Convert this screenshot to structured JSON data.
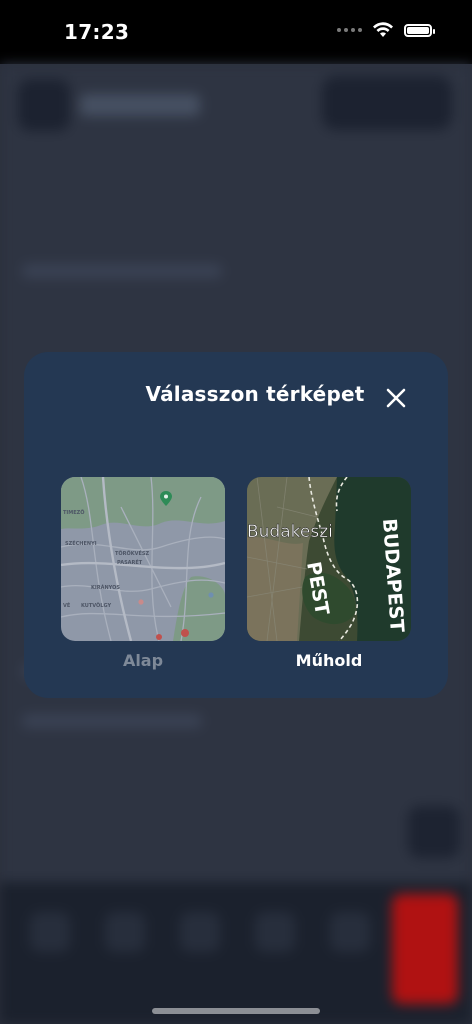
{
  "status_bar": {
    "time": "17:23"
  },
  "dialog": {
    "title": "Válasszon térképet",
    "options": [
      {
        "label": "Alap",
        "selected": false
      },
      {
        "label": "Műhold",
        "selected": true
      }
    ]
  },
  "base_map_labels": [
    "TIMEZŐ",
    "SZÉCHENYI",
    "TÖRÖKVÉSZ",
    "PASARÉT",
    "KIRÁNYOS",
    "KUTVÖLGY",
    "VÉ"
  ],
  "satellite_map_labels": [
    "Budakeszi",
    "PEST",
    "BUDAPEST"
  ],
  "colors": {
    "dialog_bg": "#243853",
    "accent_red": "#b01212",
    "pin_green": "#2e8b57"
  }
}
